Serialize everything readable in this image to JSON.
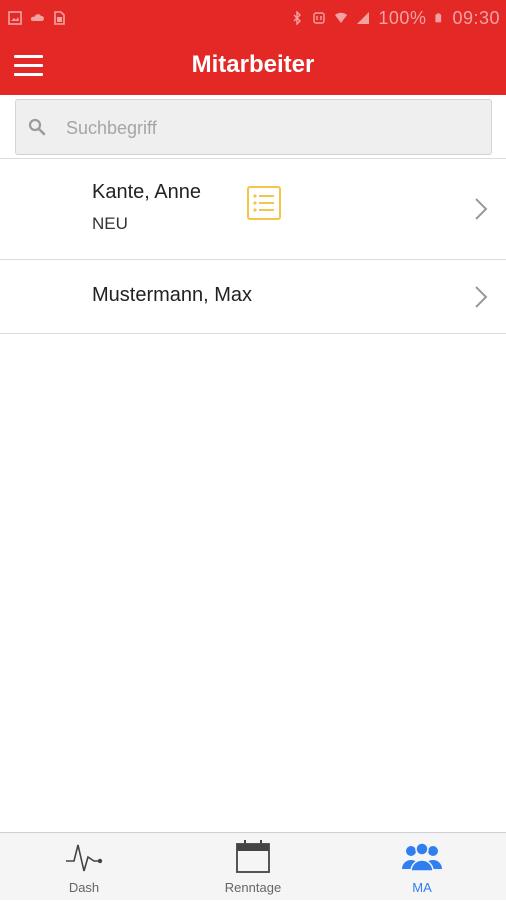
{
  "status_bar": {
    "notification_icons": [
      "image-icon",
      "cloud-icon",
      "sim-icon"
    ],
    "battery_text": "100%",
    "time": "09:30"
  },
  "app_bar": {
    "title": "Mitarbeiter",
    "menu_icon": "hamburger-menu-icon"
  },
  "search": {
    "placeholder": "Suchbegriff",
    "value": ""
  },
  "employees": [
    {
      "name": "Kante, Anne",
      "status": "NEU",
      "has_document_icon": true
    },
    {
      "name": "Mustermann, Max",
      "status": "",
      "has_document_icon": false
    }
  ],
  "tabs": [
    {
      "label": "Dash",
      "icon": "pulse-icon",
      "active": false
    },
    {
      "label": "Renntage",
      "icon": "calendar-icon",
      "active": false
    },
    {
      "label": "MA",
      "icon": "people-icon",
      "active": true
    }
  ],
  "colors": {
    "primary_red": "#e32826",
    "active_tab_blue": "#2f7ff0",
    "document_icon_yellow": "#f3c64a"
  }
}
